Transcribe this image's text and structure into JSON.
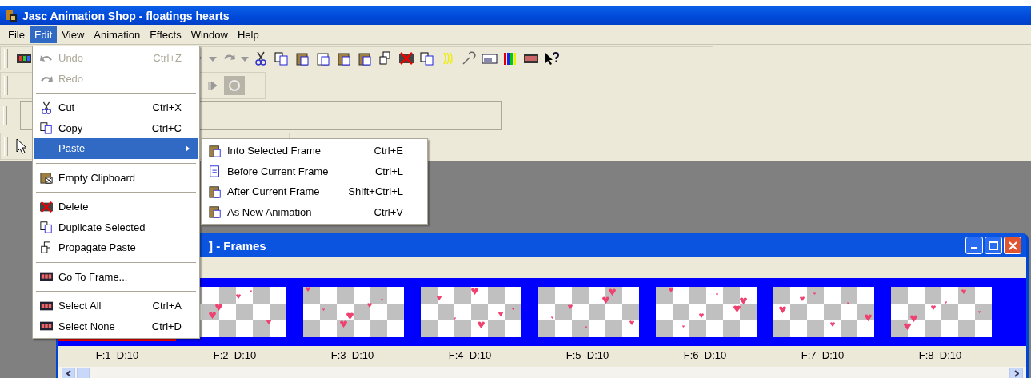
{
  "window": {
    "title": "Jasc Animation Shop - floatings hearts"
  },
  "menu_bar": [
    {
      "label": "File",
      "selected": false
    },
    {
      "label": "Edit",
      "selected": true
    },
    {
      "label": "View",
      "selected": false
    },
    {
      "label": "Animation",
      "selected": false
    },
    {
      "label": "Effects",
      "selected": false
    },
    {
      "label": "Window",
      "selected": false
    },
    {
      "label": "Help",
      "selected": false
    }
  ],
  "edit_menu": [
    {
      "kind": "item",
      "label": "Undo",
      "shortcut": "Ctrl+Z",
      "disabled": true,
      "selected": false
    },
    {
      "kind": "item",
      "label": "Redo",
      "disabled": true,
      "selected": false
    },
    {
      "kind": "separator"
    },
    {
      "kind": "item",
      "label": "Cut",
      "shortcut": "Ctrl+X",
      "disabled": false,
      "selected": false
    },
    {
      "kind": "item",
      "label": "Copy",
      "shortcut": "Ctrl+C",
      "disabled": false,
      "selected": false
    },
    {
      "kind": "submenu",
      "label": "Paste",
      "disabled": false,
      "selected": true
    },
    {
      "kind": "separator"
    },
    {
      "kind": "item",
      "label": "Empty Clipboard",
      "disabled": false,
      "selected": false
    },
    {
      "kind": "separator"
    },
    {
      "kind": "item",
      "label": "Delete",
      "disabled": false,
      "selected": false
    },
    {
      "kind": "item",
      "label": "Duplicate Selected",
      "disabled": false,
      "selected": false
    },
    {
      "kind": "item",
      "label": "Propagate Paste",
      "disabled": false,
      "selected": false
    },
    {
      "kind": "separator"
    },
    {
      "kind": "item",
      "label": "Go To Frame...",
      "disabled": false,
      "selected": false
    },
    {
      "kind": "separator"
    },
    {
      "kind": "item",
      "label": "Select All",
      "shortcut": "Ctrl+A",
      "disabled": false,
      "selected": false
    },
    {
      "kind": "item",
      "label": "Select None",
      "shortcut": "Ctrl+D",
      "disabled": false,
      "selected": false
    }
  ],
  "paste_submenu": [
    {
      "label": "Into Selected Frame",
      "shortcut": "Ctrl+E"
    },
    {
      "label": "Before Current Frame",
      "shortcut": "Ctrl+L"
    },
    {
      "label": "After Current Frame",
      "shortcut": "Shift+Ctrl+L"
    },
    {
      "label": "As New Animation",
      "shortcut": "Ctrl+V"
    }
  ],
  "frames_window": {
    "title": "] - Frames",
    "frames": [
      {
        "label": "F:1  D:10",
        "selected": true
      },
      {
        "label": "F:2  D:10",
        "selected": false
      },
      {
        "label": "F:3  D:10",
        "selected": false
      },
      {
        "label": "F:4  D:10",
        "selected": false
      },
      {
        "label": "F:5  D:10",
        "selected": false
      },
      {
        "label": "F:6  D:10",
        "selected": false
      },
      {
        "label": "F:7  D:10",
        "selected": false
      },
      {
        "label": "F:8  D:10",
        "selected": false
      }
    ]
  }
}
